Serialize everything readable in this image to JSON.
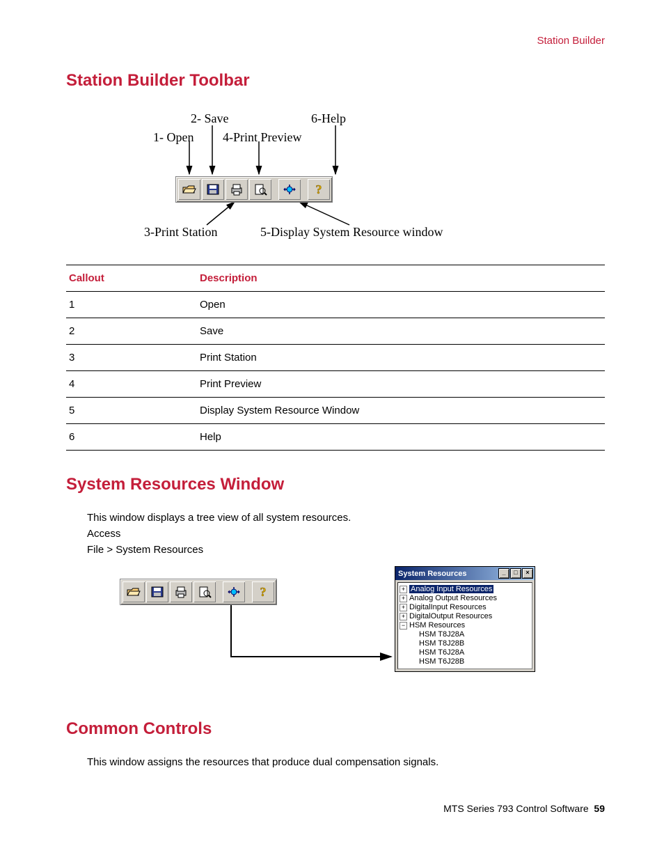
{
  "header_right": "Station Builder",
  "section1_title": "Station Builder Toolbar",
  "diagram1_labels": {
    "l1": "1- Open",
    "l2": "2- Save",
    "l3": "3-Print Station",
    "l4": "4-Print Preview",
    "l5": "5-Display System Resource window",
    "l6": "6-Help"
  },
  "table": {
    "col1": "Callout",
    "col2": "Description",
    "rows": [
      {
        "c": "1",
        "d": "Open"
      },
      {
        "c": "2",
        "d": "Save"
      },
      {
        "c": "3",
        "d": "Print Station"
      },
      {
        "c": "4",
        "d": "Print Preview"
      },
      {
        "c": "5",
        "d": "Display System Resource Window"
      },
      {
        "c": "6",
        "d": "Help"
      }
    ]
  },
  "section2_title": "System Resources Window",
  "section2_body1": "This window displays a tree view of all system resources.",
  "section2_access_label": "Access",
  "section2_access_path": "File > System Resources",
  "sysres": {
    "title": "System Resources",
    "items": {
      "i0": "Analog Input Resources",
      "i1": "Analog Output Resources",
      "i2": "DigitalInput Resources",
      "i3": "DigitalOutput Resources",
      "i4": "HSM Resources",
      "c0": "HSM T8J28A",
      "c1": "HSM T8J28B",
      "c2": "HSM T6J28A",
      "c3": "HSM T6J28B"
    }
  },
  "section3_title": "Common Controls",
  "section3_body1": "This window assigns the resources that produce dual compensation signals.",
  "footer_text": "MTS Series 793 Control Software",
  "footer_page": "59"
}
